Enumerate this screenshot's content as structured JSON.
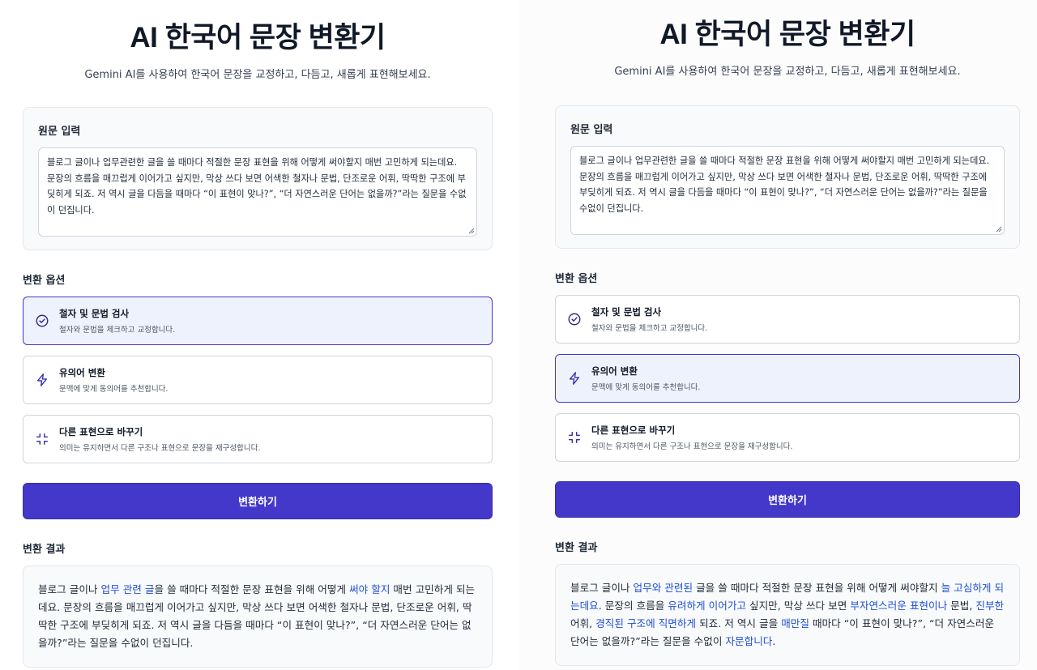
{
  "left": {
    "title": "AI 한국어 문장 변환기",
    "subtitle": "Gemini AI를 사용하여 한국어 문장을 교정하고, 다듬고, 새롭게 표현해보세요.",
    "input_label": "원문 입력",
    "input_text": "블로그 글이나 업무관련한 글을 쓸 때마다 적절한 문장 표현을 위해 어떻게 써야할지 매번 고민하게 되는데요. 문장의 흐름을 매끄럽게 이어가고 싶지만, 막상 쓰다 보면 어색한 철자나 문법, 단조로운 어휘, 딱딱한 구조에 부딪히게 되죠. 저 역시 글을 다듬을 때마다 “이 표현이 맞나?”, “더 자연스러운 단어는 없을까?”라는 질문을 수없이 던집니다.",
    "options_label": "변환 옵션",
    "options": [
      {
        "title": "철자 및 문법 검사",
        "desc": "철자와 문법을 체크하고 교정합니다.",
        "icon": "check-circle-icon",
        "selected": true
      },
      {
        "title": "유의어 변환",
        "desc": "문맥에 맞게 동의어를 추천합니다.",
        "icon": "lightning-icon",
        "selected": false
      },
      {
        "title": "다른 표현으로 바꾸기",
        "desc": "의미는 유지하면서 다른 구조나 표현으로 문장을 재구성합니다.",
        "icon": "shrink-icon",
        "selected": false
      }
    ],
    "convert_label": "변환하기",
    "result_label": "변환 결과",
    "result_segments": [
      {
        "text": "블로그 글이나 ",
        "hl": false
      },
      {
        "text": "업무 관련 글",
        "hl": true
      },
      {
        "text": "을 쓸 때마다 적절한 문장 표현을 위해 어떻게 ",
        "hl": false
      },
      {
        "text": "써야 할지",
        "hl": true
      },
      {
        "text": " 매번 고민하게 되는데요. 문장의 흐름을 매끄럽게 이어가고 싶지만, 막상 쓰다 보면 어색한 철자나 문법, 단조로운 어휘, 딱딱한 구조에 부딪히게 되죠. 저 역시 글을 다듬을 때마다 “이 표현이 맞나?”, “더 자연스러운 단어는 없을까?”라는 질문을 수없이 던집니다.",
        "hl": false
      }
    ]
  },
  "right": {
    "title": "AI 한국어 문장 변환기",
    "subtitle": "Gemini AI를 사용하여 한국어 문장을 교정하고, 다듬고, 새롭게 표현해보세요.",
    "input_label": "원문 입력",
    "input_text": "블로그 글이나 업무관련한 글을 쓸 때마다 적절한 문장 표현을 위해 어떻게 써야할지 매번 고민하게 되는데요. 문장의 흐름을 매끄럽게 이어가고 싶지만, 막상 쓰다 보면 어색한 철자나 문법, 단조로운 어휘, 딱딱한 구조에 부딪히게 되죠. 저 역시 글을 다듬을 때마다 “이 표현이 맞나?”, “더 자연스러운 단어는 없을까?”라는 질문을 수없이 던집니다.",
    "options_label": "변환 옵션",
    "options": [
      {
        "title": "철자 및 문법 검사",
        "desc": "철자와 문법을 체크하고 교정합니다.",
        "icon": "check-circle-icon",
        "selected": false
      },
      {
        "title": "유의어 변환",
        "desc": "문맥에 맞게 동의어를 추천합니다.",
        "icon": "lightning-icon",
        "selected": true
      },
      {
        "title": "다른 표현으로 바꾸기",
        "desc": "의미는 유지하면서 다른 구조나 표현으로 문장을 재구성합니다.",
        "icon": "shrink-icon",
        "selected": false
      }
    ],
    "convert_label": "변환하기",
    "result_label": "변환 결과",
    "result_segments": [
      {
        "text": "블로그 글이나 ",
        "hl": false
      },
      {
        "text": "업무와 관련된",
        "hl": true
      },
      {
        "text": " 글을 쓸 때마다 적절한 문장 표현을 위해 어떻게 써야할지 ",
        "hl": false
      },
      {
        "text": "늘 고심하게 되는데요",
        "hl": true
      },
      {
        "text": ". 문장의 흐름을 ",
        "hl": false
      },
      {
        "text": "유려하게 이어가고",
        "hl": true
      },
      {
        "text": " 싶지만, 막상 쓰다 보면 ",
        "hl": false
      },
      {
        "text": "부자연스러운 표현이나",
        "hl": true
      },
      {
        "text": " 문법, ",
        "hl": false
      },
      {
        "text": "진부한",
        "hl": true
      },
      {
        "text": " 어휘, ",
        "hl": false
      },
      {
        "text": "경직된 구조에 직면하게",
        "hl": true
      },
      {
        "text": " 되죠. 저 역시 글을 ",
        "hl": false
      },
      {
        "text": "매만질",
        "hl": true
      },
      {
        "text": " 때마다 “이 표현이 맞나?”, “더 자연스러운 단어는 없을까?”라는 질문을 수없이 ",
        "hl": false
      },
      {
        "text": "자문합니다",
        "hl": true
      },
      {
        "text": ".",
        "hl": false
      }
    ]
  },
  "colors": {
    "accent": "#4338ca",
    "highlight": "#1d4ed8",
    "selected_bg": "#eef2fd"
  }
}
